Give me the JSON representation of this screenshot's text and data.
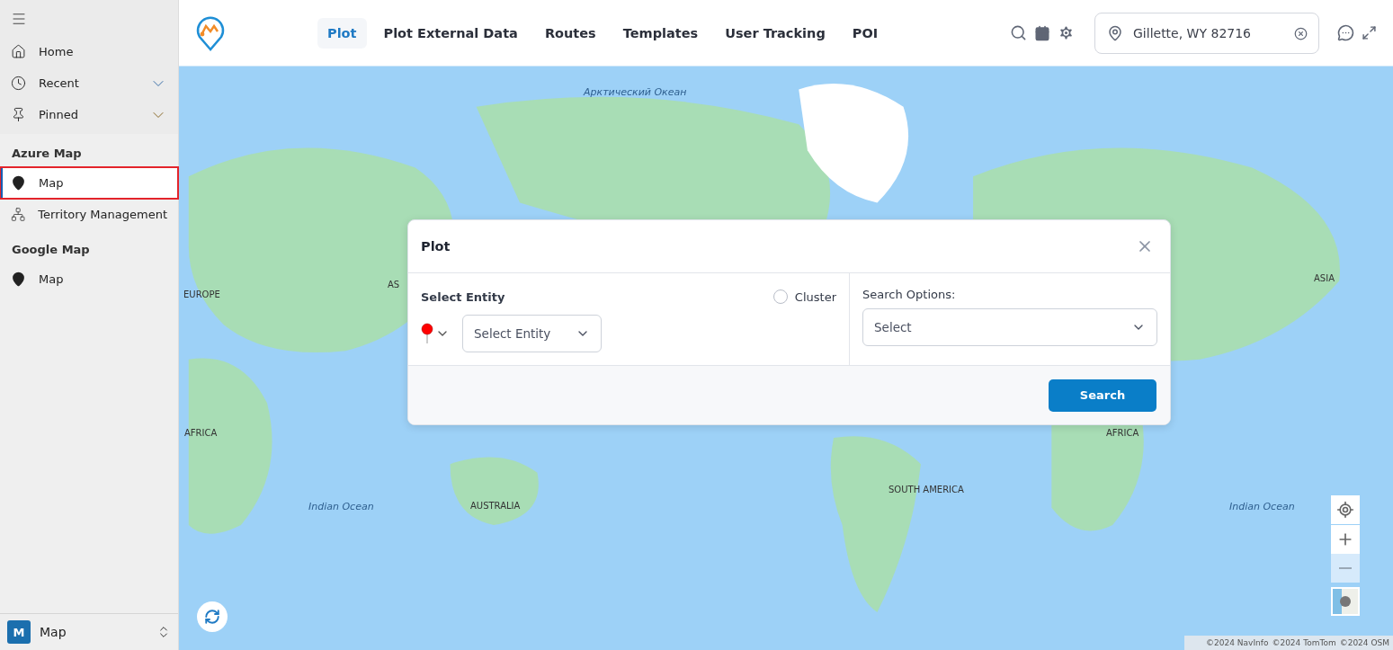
{
  "sidebar": {
    "top_items": [
      {
        "label": "Home"
      },
      {
        "label": "Recent",
        "expanded": false
      },
      {
        "label": "Pinned",
        "expanded": false
      }
    ],
    "sections": [
      {
        "title": "Azure Map",
        "items": [
          {
            "label": "Map",
            "selected": true,
            "highlighted": true
          },
          {
            "label": "Territory Management",
            "selected": false,
            "highlighted": false
          }
        ]
      },
      {
        "title": "Google Map",
        "items": [
          {
            "label": "Map",
            "selected": false,
            "highlighted": false
          }
        ]
      }
    ],
    "footer": {
      "badge": "M",
      "label": "Map"
    }
  },
  "header": {
    "tabs": [
      {
        "label": "Plot",
        "selected": true
      },
      {
        "label": "Plot External Data",
        "selected": false
      },
      {
        "label": "Routes",
        "selected": false
      },
      {
        "label": "Templates",
        "selected": false
      },
      {
        "label": "User Tracking",
        "selected": false
      },
      {
        "label": "POI",
        "selected": false
      }
    ],
    "location": {
      "value": "Gillette, WY 82716"
    }
  },
  "map": {
    "labels": [
      "Арктический Океан",
      "AS",
      "ASIA",
      "EUROPE",
      "AFRICA",
      "AFRICA",
      "SOUTH AMERICA",
      "Indian Ocean",
      "AUSTRALIA",
      "Indian Ocean"
    ],
    "attribution": [
      "©2024 NavInfo",
      "©2024 TomTom",
      "©2024 OSM"
    ]
  },
  "dialog": {
    "title": "Plot",
    "entity_label": "Select Entity",
    "cluster": {
      "label": "Cluster",
      "checked": false
    },
    "entity_select": {
      "placeholder": "Select Entity"
    },
    "options_label": "Search Options:",
    "options_select": {
      "placeholder": "Select"
    },
    "button": "Search"
  }
}
